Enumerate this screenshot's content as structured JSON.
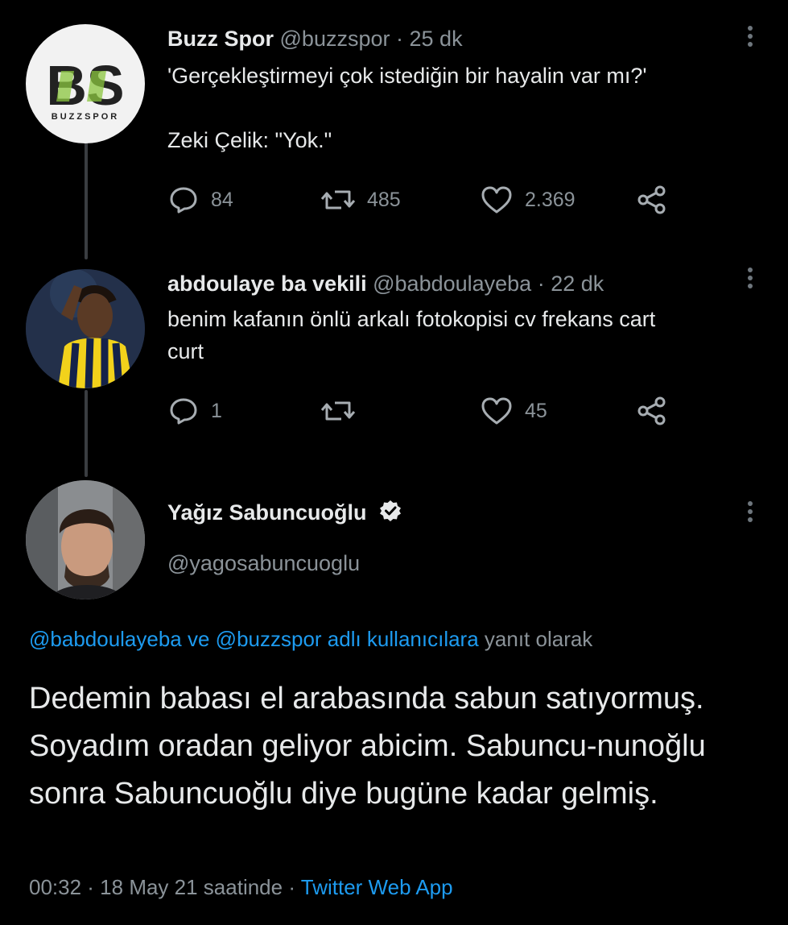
{
  "tweets": [
    {
      "name": "Buzz Spor",
      "handle": "@buzzspor",
      "dot": "·",
      "time": "25 dk",
      "text": "'Gerçekleştirmeyi çok istediğin bir hayalin var mı?'\n\nZeki Çelik: \"Yok.\"",
      "avatar_letters": "BS",
      "avatar_caption": "BUZZSPOR",
      "replies": "84",
      "retweets": "485",
      "likes": "2.369"
    },
    {
      "name": "abdoulaye ba vekili",
      "handle": "@babdoulayeba",
      "dot": "·",
      "time": "22 dk",
      "text": "benim kafanın önlü arkalı fotokopisi cv frekans cart\ncurt",
      "replies": "1",
      "retweets": "",
      "likes": "45"
    }
  ],
  "main": {
    "name": "Yağız Sabuncuoğlu",
    "handle": "@yagosabuncuoglu",
    "reply_prefix_links": "@babdoulayeba ve @buzzspor adlı kullanıcılara",
    "reply_suffix": "yanıt olarak",
    "text": "Dedemin babası el arabasında sabun satıyormuş. Soyadım oradan geliyor abicim. Sabuncu-nunoğlu sonra Sabuncuoğlu diye bugüne kadar gelmiş.",
    "timestamp": "00:32 · 18 May 21 saatinde ·",
    "source": "Twitter Web App"
  },
  "icons": {
    "reply": "reply-icon",
    "retweet": "retweet-icon",
    "like": "heart-icon",
    "share": "share-icon",
    "more": "more-options-icon",
    "verified": "verified-badge-icon"
  },
  "colors": {
    "background": "#000000",
    "text": "#e7e9ea",
    "muted": "#8b9399",
    "link": "#1d9bf0",
    "logo_green": "#8bc53f"
  }
}
